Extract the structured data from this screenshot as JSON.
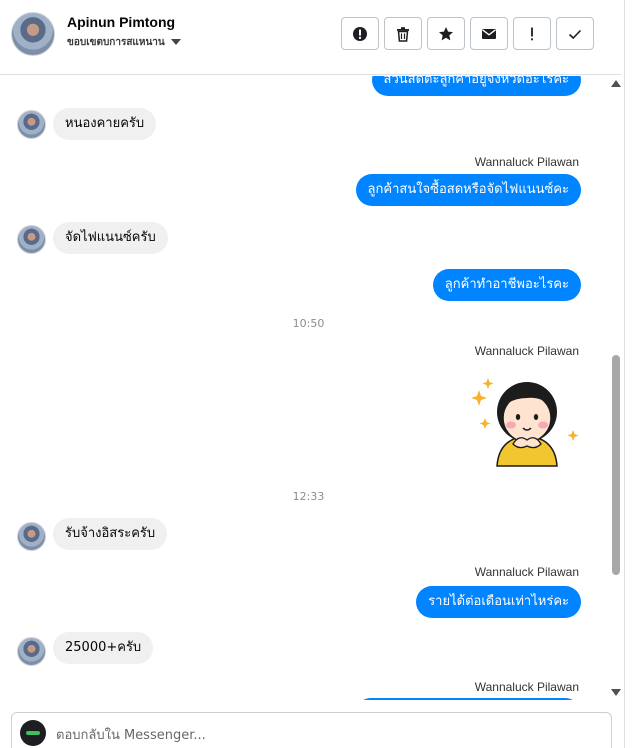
{
  "header": {
    "contact_name": "Apinun Pimtong",
    "contact_subtitle": "ขอบเขตบการสแหนาน"
  },
  "toolbar": [
    {
      "name": "alert-circle-icon",
      "label": "Mark as spam"
    },
    {
      "name": "trash-icon",
      "label": "Delete"
    },
    {
      "name": "star-icon",
      "label": "Star"
    },
    {
      "name": "envelope-icon",
      "label": "Mark unread"
    },
    {
      "name": "exclamation-icon",
      "label": "Follow up"
    },
    {
      "name": "check-icon",
      "label": "Done"
    }
  ],
  "thread": {
    "partial_top": "ส่วนสดตะลูกค้าอยู่จังหวัดอะไรคะ",
    "m1": "หนองคายครับ",
    "sender1": "Wannaluck Pilawan",
    "m2": "ลูกค้าสนใจซื้อสดหรือจัดไฟแนนซ์คะ",
    "m3": "จัดไฟแนนซ์ครับ",
    "m4": "ลูกค้าทำอาชีพอะไรคะ",
    "time1": "10:50",
    "sender2": "Wannaluck Pilawan",
    "time2": "12:33",
    "m5": "รับจ้างอิสระครับ",
    "sender3": "Wannaluck Pilawan",
    "m6": "รายได้ต่อเดือนเท่าไหร่คะ",
    "m7": "25000+ครับ",
    "sender4": "Wannaluck Pilawan"
  },
  "composer": {
    "placeholder": "ตอบกลับใน Messenger..."
  },
  "colors": {
    "outgoing_bubble": "#0084ff",
    "incoming_bubble": "#f0f0f0"
  }
}
